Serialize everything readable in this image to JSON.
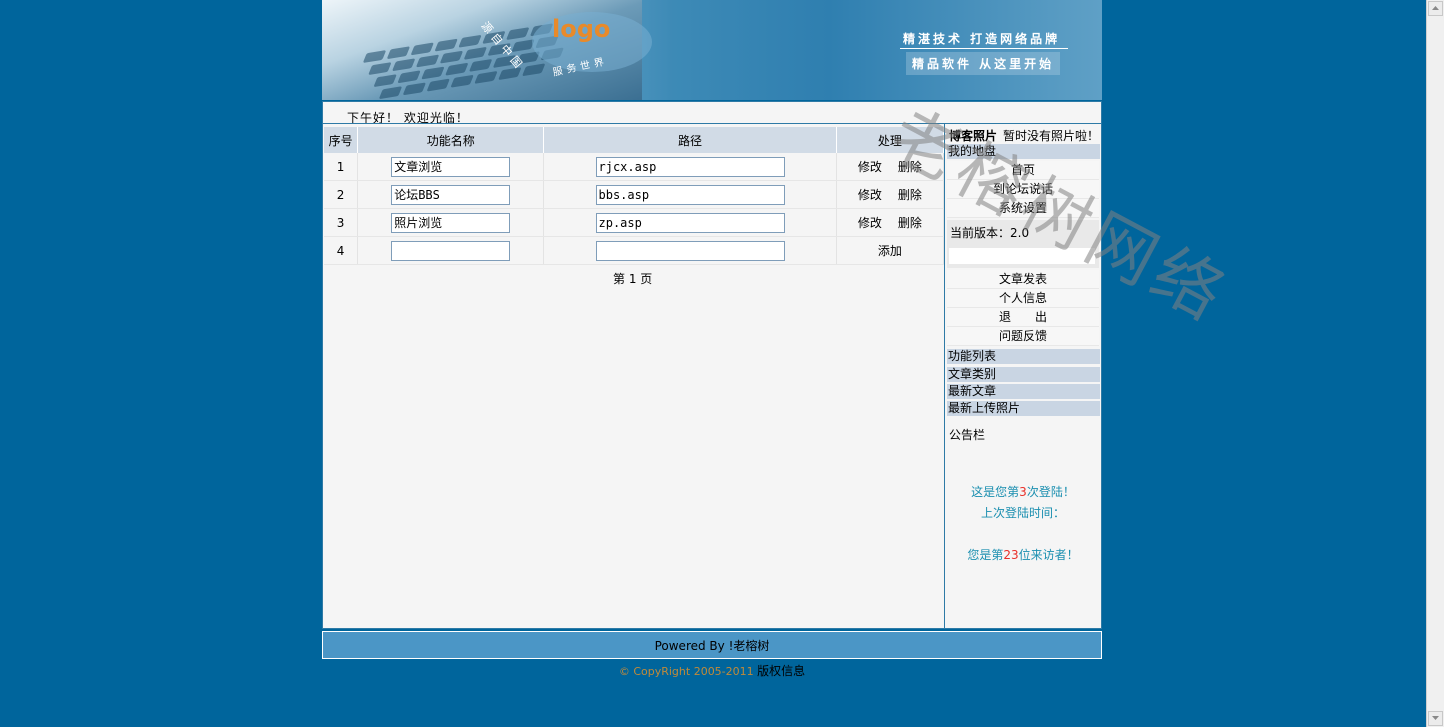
{
  "banner": {
    "logo": "logo",
    "arc_text": "源自中国",
    "arc_text2": "服务世界",
    "slogan1": "精湛技术 打造网络品牌",
    "slogan2": "精品软件 从这里开始"
  },
  "greeting": "下午好！ 欢迎光临！",
  "table": {
    "headers": [
      "序号",
      "功能名称",
      "路径",
      "处理"
    ],
    "rows": [
      {
        "no": "1",
        "name": "文章浏览",
        "path": "rjcx.asp",
        "edit": "修改",
        "del": "删除"
      },
      {
        "no": "2",
        "name": "论坛BBS",
        "path": "bbs.asp",
        "edit": "修改",
        "del": "删除"
      },
      {
        "no": "3",
        "name": "照片浏览",
        "path": "zp.asp",
        "edit": "修改",
        "del": "删除"
      },
      {
        "no": "4",
        "name": "",
        "path": "",
        "add": "添加"
      }
    ],
    "pager": "第 1 页"
  },
  "side": {
    "blog_title": "博客照片",
    "blog_note": "暂时没有照片啦！",
    "my_area": "我的地盘",
    "links1": [
      "首页",
      "到论坛说话",
      "系统设置"
    ],
    "version": "当前版本：2.0",
    "links2": [
      "文章发表",
      "个人信息",
      "退　　出",
      "问题反馈"
    ],
    "bars": [
      "功能列表",
      "文章类别",
      "最新文章",
      "最新上传照片"
    ],
    "notice": "公告栏",
    "login_pre": "这是您第",
    "login_count": "3",
    "login_post": "次登陆！",
    "last_login": "上次登陆时间：",
    "visitor_pre": "您是第",
    "visitor_count": "23",
    "visitor_post": "位来访者！"
  },
  "footer": {
    "powered": "Powered By !老榕树",
    "copyright": "© CopyRight 2005-2011",
    "copyright_link": "版权信息"
  },
  "watermark": "老榕树网络"
}
